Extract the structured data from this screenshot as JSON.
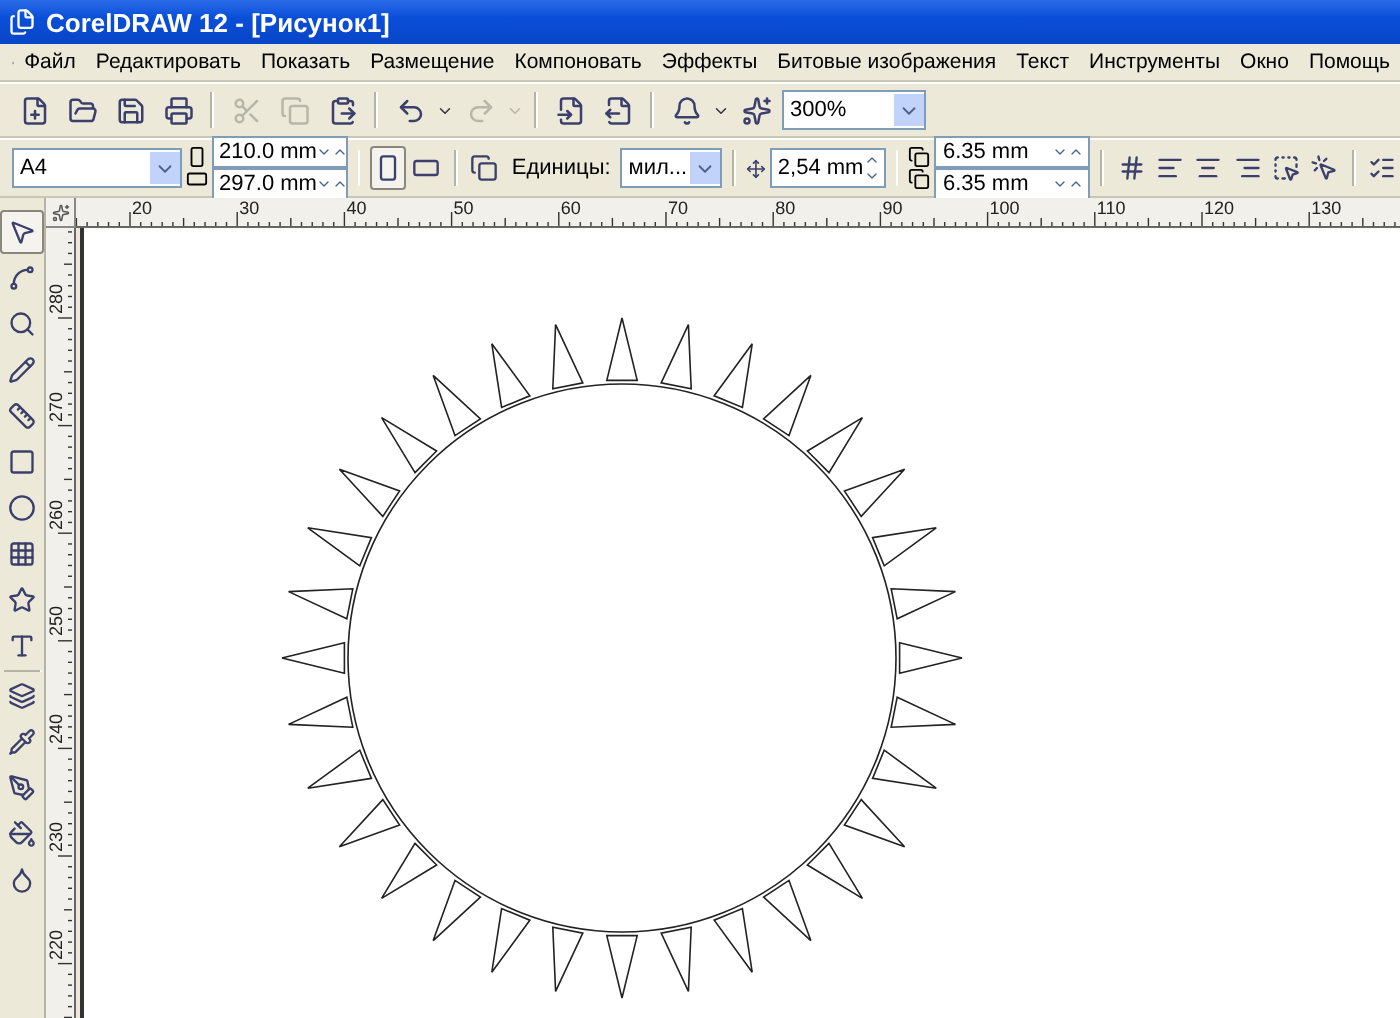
{
  "window": {
    "title": "CorelDRAW 12 - [Рисунок1]"
  },
  "menu": [
    "Файл",
    "Редактировать",
    "Показать",
    "Размещение",
    "Компоновать",
    "Эффекты",
    "Битовые изображения",
    "Текст",
    "Инструменты",
    "Окно",
    "Помощь"
  ],
  "toolbar": {
    "tools": [
      {
        "kind": "new",
        "disabled": false
      },
      {
        "kind": "open",
        "disabled": false
      },
      {
        "kind": "save",
        "disabled": false
      },
      {
        "kind": "print",
        "disabled": false
      },
      {
        "kind": "cut",
        "disabled": true
      },
      {
        "kind": "copy",
        "disabled": true
      },
      {
        "kind": "paste",
        "disabled": false
      },
      {
        "kind": "undo",
        "disabled": false
      },
      {
        "kind": "redo",
        "disabled": true
      },
      {
        "kind": "import",
        "disabled": false
      },
      {
        "kind": "export",
        "disabled": false
      },
      {
        "kind": "launcher",
        "disabled": false
      },
      {
        "kind": "online",
        "disabled": false
      }
    ],
    "zoom": "300%"
  },
  "property_bar": {
    "page_size": "A4",
    "width": "210.0 mm",
    "height": "297.0 mm",
    "portrait": true,
    "units_label": "Единицы:",
    "units": "мил...",
    "nudge": "2,54 mm",
    "duplicate_x": "6.35 mm",
    "duplicate_y": "6.35 mm"
  },
  "rulers": {
    "horizontal": [
      "20",
      "30",
      "40",
      "50",
      "60",
      "70",
      "80",
      "90",
      "100",
      "110",
      "120",
      "130"
    ],
    "vertical": [
      "280",
      "270",
      "260",
      "250",
      "240",
      "230",
      "220"
    ]
  },
  "toolbox": [
    {
      "kind": "pick",
      "selected": true
    },
    {
      "kind": "shape",
      "selected": false
    },
    {
      "kind": "zoom",
      "selected": false
    },
    {
      "kind": "freehand",
      "selected": false
    },
    {
      "kind": "dimension",
      "selected": false
    },
    {
      "kind": "rectangle",
      "selected": false
    },
    {
      "kind": "ellipse",
      "selected": false
    },
    {
      "kind": "table",
      "selected": false
    },
    {
      "kind": "star",
      "selected": false
    },
    {
      "kind": "text",
      "selected": false
    },
    {
      "kind": "blend",
      "selected": false
    },
    {
      "kind": "eyedropper",
      "selected": false
    },
    {
      "kind": "outline",
      "selected": false
    },
    {
      "kind": "fill",
      "selected": false
    },
    {
      "kind": "interactive_fill",
      "selected": false
    }
  ]
}
